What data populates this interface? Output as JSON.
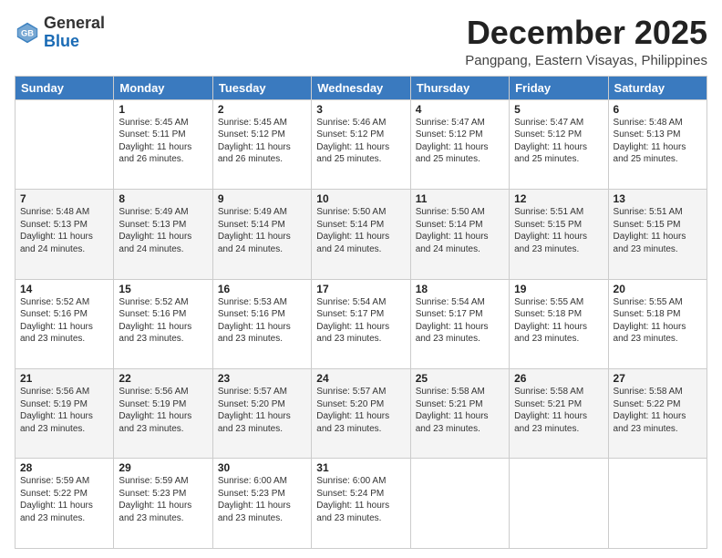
{
  "header": {
    "logo_general": "General",
    "logo_blue": "Blue",
    "month_title": "December 2025",
    "location": "Pangpang, Eastern Visayas, Philippines"
  },
  "calendar": {
    "days_of_week": [
      "Sunday",
      "Monday",
      "Tuesday",
      "Wednesday",
      "Thursday",
      "Friday",
      "Saturday"
    ],
    "weeks": [
      [
        {
          "day": "",
          "sunrise": "",
          "sunset": "",
          "daylight": ""
        },
        {
          "day": "1",
          "sunrise": "Sunrise: 5:45 AM",
          "sunset": "Sunset: 5:11 PM",
          "daylight": "Daylight: 11 hours and 26 minutes."
        },
        {
          "day": "2",
          "sunrise": "Sunrise: 5:45 AM",
          "sunset": "Sunset: 5:12 PM",
          "daylight": "Daylight: 11 hours and 26 minutes."
        },
        {
          "day": "3",
          "sunrise": "Sunrise: 5:46 AM",
          "sunset": "Sunset: 5:12 PM",
          "daylight": "Daylight: 11 hours and 25 minutes."
        },
        {
          "day": "4",
          "sunrise": "Sunrise: 5:47 AM",
          "sunset": "Sunset: 5:12 PM",
          "daylight": "Daylight: 11 hours and 25 minutes."
        },
        {
          "day": "5",
          "sunrise": "Sunrise: 5:47 AM",
          "sunset": "Sunset: 5:12 PM",
          "daylight": "Daylight: 11 hours and 25 minutes."
        },
        {
          "day": "6",
          "sunrise": "Sunrise: 5:48 AM",
          "sunset": "Sunset: 5:13 PM",
          "daylight": "Daylight: 11 hours and 25 minutes."
        }
      ],
      [
        {
          "day": "7",
          "sunrise": "Sunrise: 5:48 AM",
          "sunset": "Sunset: 5:13 PM",
          "daylight": "Daylight: 11 hours and 24 minutes."
        },
        {
          "day": "8",
          "sunrise": "Sunrise: 5:49 AM",
          "sunset": "Sunset: 5:13 PM",
          "daylight": "Daylight: 11 hours and 24 minutes."
        },
        {
          "day": "9",
          "sunrise": "Sunrise: 5:49 AM",
          "sunset": "Sunset: 5:14 PM",
          "daylight": "Daylight: 11 hours and 24 minutes."
        },
        {
          "day": "10",
          "sunrise": "Sunrise: 5:50 AM",
          "sunset": "Sunset: 5:14 PM",
          "daylight": "Daylight: 11 hours and 24 minutes."
        },
        {
          "day": "11",
          "sunrise": "Sunrise: 5:50 AM",
          "sunset": "Sunset: 5:14 PM",
          "daylight": "Daylight: 11 hours and 24 minutes."
        },
        {
          "day": "12",
          "sunrise": "Sunrise: 5:51 AM",
          "sunset": "Sunset: 5:15 PM",
          "daylight": "Daylight: 11 hours and 23 minutes."
        },
        {
          "day": "13",
          "sunrise": "Sunrise: 5:51 AM",
          "sunset": "Sunset: 5:15 PM",
          "daylight": "Daylight: 11 hours and 23 minutes."
        }
      ],
      [
        {
          "day": "14",
          "sunrise": "Sunrise: 5:52 AM",
          "sunset": "Sunset: 5:16 PM",
          "daylight": "Daylight: 11 hours and 23 minutes."
        },
        {
          "day": "15",
          "sunrise": "Sunrise: 5:52 AM",
          "sunset": "Sunset: 5:16 PM",
          "daylight": "Daylight: 11 hours and 23 minutes."
        },
        {
          "day": "16",
          "sunrise": "Sunrise: 5:53 AM",
          "sunset": "Sunset: 5:16 PM",
          "daylight": "Daylight: 11 hours and 23 minutes."
        },
        {
          "day": "17",
          "sunrise": "Sunrise: 5:54 AM",
          "sunset": "Sunset: 5:17 PM",
          "daylight": "Daylight: 11 hours and 23 minutes."
        },
        {
          "day": "18",
          "sunrise": "Sunrise: 5:54 AM",
          "sunset": "Sunset: 5:17 PM",
          "daylight": "Daylight: 11 hours and 23 minutes."
        },
        {
          "day": "19",
          "sunrise": "Sunrise: 5:55 AM",
          "sunset": "Sunset: 5:18 PM",
          "daylight": "Daylight: 11 hours and 23 minutes."
        },
        {
          "day": "20",
          "sunrise": "Sunrise: 5:55 AM",
          "sunset": "Sunset: 5:18 PM",
          "daylight": "Daylight: 11 hours and 23 minutes."
        }
      ],
      [
        {
          "day": "21",
          "sunrise": "Sunrise: 5:56 AM",
          "sunset": "Sunset: 5:19 PM",
          "daylight": "Daylight: 11 hours and 23 minutes."
        },
        {
          "day": "22",
          "sunrise": "Sunrise: 5:56 AM",
          "sunset": "Sunset: 5:19 PM",
          "daylight": "Daylight: 11 hours and 23 minutes."
        },
        {
          "day": "23",
          "sunrise": "Sunrise: 5:57 AM",
          "sunset": "Sunset: 5:20 PM",
          "daylight": "Daylight: 11 hours and 23 minutes."
        },
        {
          "day": "24",
          "sunrise": "Sunrise: 5:57 AM",
          "sunset": "Sunset: 5:20 PM",
          "daylight": "Daylight: 11 hours and 23 minutes."
        },
        {
          "day": "25",
          "sunrise": "Sunrise: 5:58 AM",
          "sunset": "Sunset: 5:21 PM",
          "daylight": "Daylight: 11 hours and 23 minutes."
        },
        {
          "day": "26",
          "sunrise": "Sunrise: 5:58 AM",
          "sunset": "Sunset: 5:21 PM",
          "daylight": "Daylight: 11 hours and 23 minutes."
        },
        {
          "day": "27",
          "sunrise": "Sunrise: 5:58 AM",
          "sunset": "Sunset: 5:22 PM",
          "daylight": "Daylight: 11 hours and 23 minutes."
        }
      ],
      [
        {
          "day": "28",
          "sunrise": "Sunrise: 5:59 AM",
          "sunset": "Sunset: 5:22 PM",
          "daylight": "Daylight: 11 hours and 23 minutes."
        },
        {
          "day": "29",
          "sunrise": "Sunrise: 5:59 AM",
          "sunset": "Sunset: 5:23 PM",
          "daylight": "Daylight: 11 hours and 23 minutes."
        },
        {
          "day": "30",
          "sunrise": "Sunrise: 6:00 AM",
          "sunset": "Sunset: 5:23 PM",
          "daylight": "Daylight: 11 hours and 23 minutes."
        },
        {
          "day": "31",
          "sunrise": "Sunrise: 6:00 AM",
          "sunset": "Sunset: 5:24 PM",
          "daylight": "Daylight: 11 hours and 23 minutes."
        },
        {
          "day": "",
          "sunrise": "",
          "sunset": "",
          "daylight": ""
        },
        {
          "day": "",
          "sunrise": "",
          "sunset": "",
          "daylight": ""
        },
        {
          "day": "",
          "sunrise": "",
          "sunset": "",
          "daylight": ""
        }
      ]
    ]
  }
}
